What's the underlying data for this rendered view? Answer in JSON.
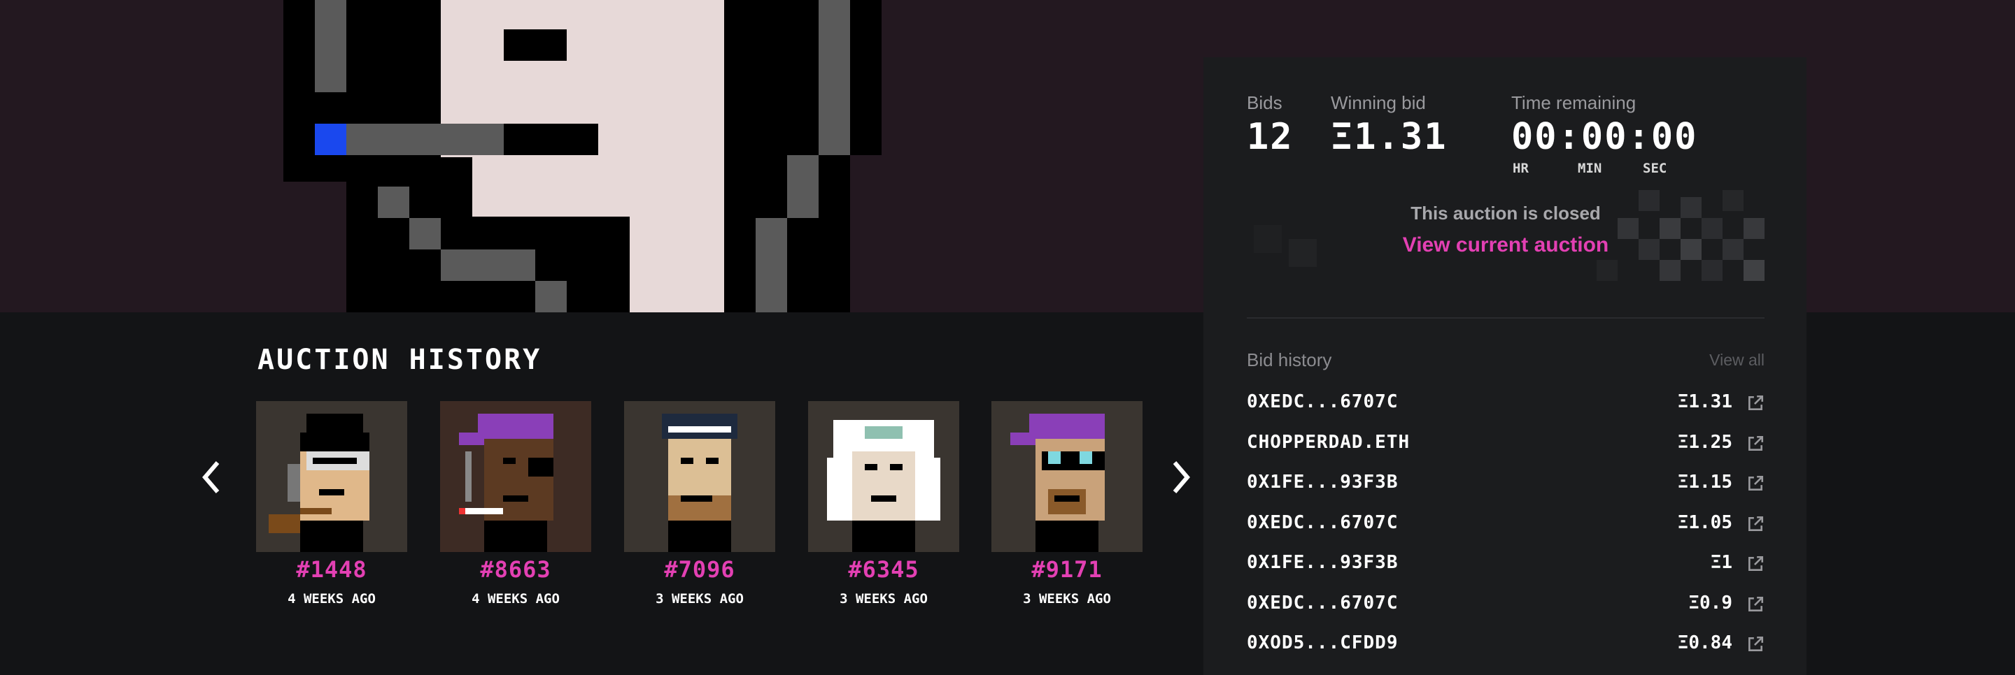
{
  "auction": {
    "bids_label": "Bids",
    "bids_count": "12",
    "winning_bid_label": "Winning bid",
    "winning_bid": "Ξ1.31",
    "time_label": "Time remaining",
    "time_value": "00:00:00",
    "units": {
      "hr": "HR",
      "min": "MIN",
      "sec": "SEC"
    },
    "closed_text": "This auction is closed",
    "view_current": "View current auction"
  },
  "bid_history": {
    "title": "Bid history",
    "view_all": "View all",
    "rows": [
      {
        "bidder": "0XEDC...6707C",
        "amount": "Ξ1.31"
      },
      {
        "bidder": "CHOPPERDAD.ETH",
        "amount": "Ξ1.25"
      },
      {
        "bidder": "0X1FE...93F3B",
        "amount": "Ξ1.15"
      },
      {
        "bidder": "0XEDC...6707C",
        "amount": "Ξ1.05"
      },
      {
        "bidder": "0X1FE...93F3B",
        "amount": "Ξ1"
      },
      {
        "bidder": "0XEDC...6707C",
        "amount": "Ξ0.9"
      },
      {
        "bidder": "0XOD5...CFDD9",
        "amount": "Ξ0.84"
      }
    ]
  },
  "history": {
    "title": "AUCTION HISTORY",
    "items": [
      {
        "id": "#1448",
        "time": "4 WEEKS AGO"
      },
      {
        "id": "#8663",
        "time": "4 WEEKS AGO"
      },
      {
        "id": "#7096",
        "time": "3 WEEKS AGO"
      },
      {
        "id": "#6345",
        "time": "3 WEEKS AGO"
      },
      {
        "id": "#9171",
        "time": "3 WEEKS AGO"
      }
    ]
  },
  "colors": {
    "accent": "#e340b3",
    "hero_bg": "#231820",
    "page_bg": "#131416",
    "panel_bg": "#1b1c1e"
  }
}
